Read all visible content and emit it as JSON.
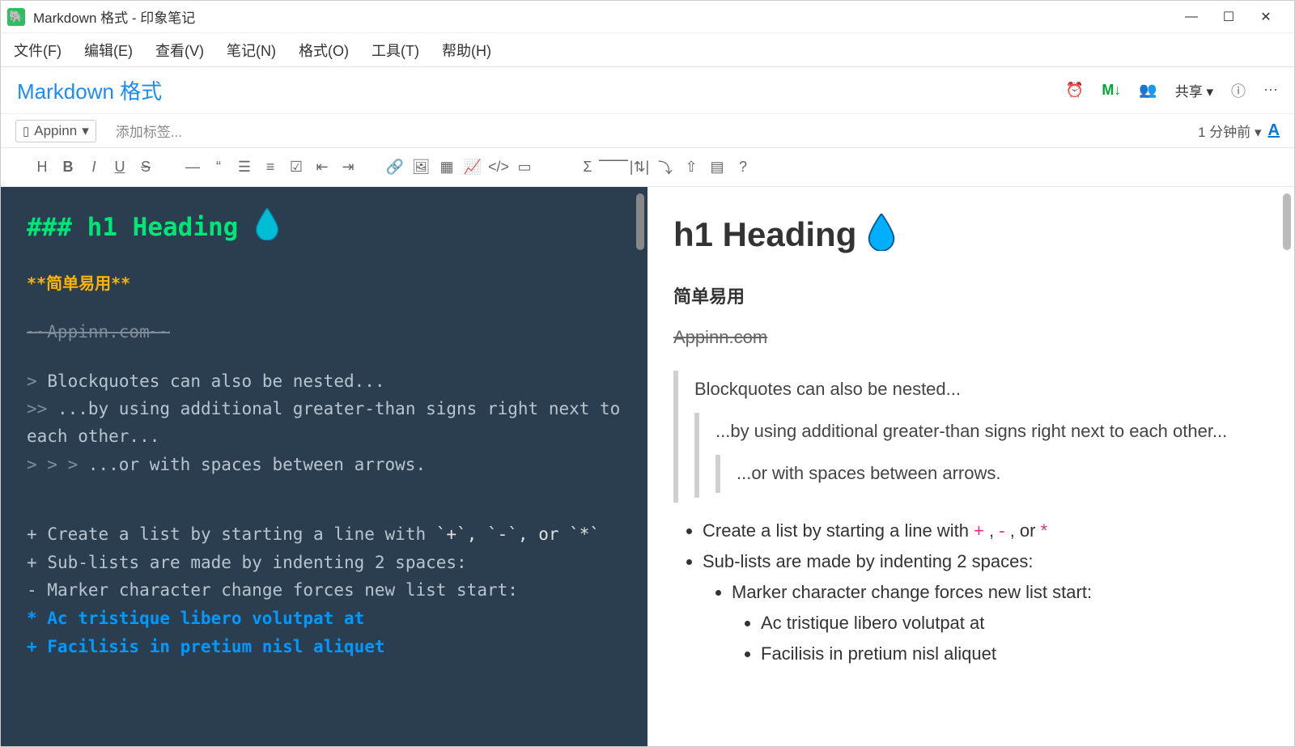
{
  "window": {
    "title": "Markdown 格式 - 印象笔记"
  },
  "menu": {
    "file": "文件(F)",
    "edit": "编辑(E)",
    "view": "查看(V)",
    "note": "笔记(N)",
    "format": "格式(O)",
    "tools": "工具(T)",
    "help": "帮助(H)"
  },
  "note": {
    "title": "Markdown 格式",
    "share_label": "共享",
    "notebook": "Appinn",
    "tag_placeholder": "添加标签...",
    "timestamp": "1 分钟前"
  },
  "editor": {
    "heading_mark": "###",
    "heading_text": "h1 Heading",
    "bold_raw": "**简单易用**",
    "strike_raw": "~~Appinn.com~~",
    "bq1_mark": ">",
    "bq1_text": "Blockquotes can also be nested...",
    "bq2_mark": ">>",
    "bq2_text": "...by using additional greater-than signs right next to each other...",
    "bq3_mark": "> > >",
    "bq3_text": "...or with spaces between arrows.",
    "li1_mark": "+",
    "li1_text": "Create a list by starting a line with",
    "li1_code": "`+`, `-`, or `*`",
    "li2_mark": "+",
    "li2_text": "Sub-lists are made by indenting 2 spaces:",
    "li3_mark": "  -",
    "li3_text": "Marker character change forces new list start:",
    "li4": "    * Ac tristique libero volutpat at",
    "li5": "    + Facilisis in pretium nisl aliquet"
  },
  "preview": {
    "heading": "h1 Heading",
    "bold": "简单易用",
    "strike": "Appinn.com",
    "bq1": "Blockquotes can also be nested...",
    "bq2": "...by using additional greater-than signs right next to each other...",
    "bq3": "...or with spaces between arrows.",
    "li1a": "Create a list by starting a line with ",
    "li1_plus": "+",
    "li1_sep1": " , ",
    "li1_dash": "-",
    "li1_sep2": " , or ",
    "li1_star": "*",
    "li2": "Sub-lists are made by indenting 2 spaces:",
    "li3": "Marker character change forces new list start:",
    "li4": "Ac tristique libero volutpat at",
    "li5": "Facilisis in pretium nisl aliquet"
  }
}
